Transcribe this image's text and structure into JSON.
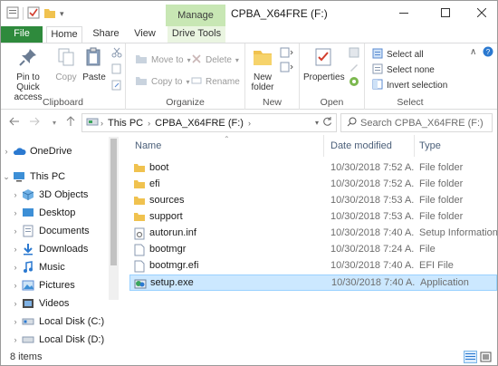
{
  "window": {
    "title": "CPBA_X64FRE (F:)",
    "context_tab": "Manage",
    "controls": {
      "minimize": "—",
      "maximize": "☐",
      "close": "✕"
    }
  },
  "ribbon_tabs": [
    "File",
    "Home",
    "Share",
    "View",
    "Drive Tools"
  ],
  "ribbon": {
    "clipboard": {
      "pin_label": "Pin to Quick access",
      "copy_label": "Copy",
      "paste_label": "Paste",
      "group_label": "Clipboard"
    },
    "organize": {
      "move_to": "Move to",
      "copy_to": "Copy to",
      "delete": "Delete",
      "rename": "Rename",
      "group_label": "Organize"
    },
    "new": {
      "new_folder": "New folder",
      "group_label": "New"
    },
    "open": {
      "properties": "Properties",
      "group_label": "Open"
    },
    "select": {
      "select_all": "Select all",
      "select_none": "Select none",
      "invert_selection": "Invert selection",
      "group_label": "Select"
    }
  },
  "address": {
    "crumbs": [
      "This PC",
      "CPBA_X64FRE (F:)"
    ],
    "search_placeholder": "Search CPBA_X64FRE (F:)"
  },
  "nav": {
    "items": [
      {
        "label": "OneDrive",
        "icon": "cloud-icon"
      },
      {
        "label": "This PC",
        "icon": "computer-icon"
      },
      {
        "label": "3D Objects",
        "icon": "cube-icon"
      },
      {
        "label": "Desktop",
        "icon": "desktop-icon"
      },
      {
        "label": "Documents",
        "icon": "documents-icon"
      },
      {
        "label": "Downloads",
        "icon": "download-icon"
      },
      {
        "label": "Music",
        "icon": "music-icon"
      },
      {
        "label": "Pictures",
        "icon": "pictures-icon"
      },
      {
        "label": "Videos",
        "icon": "videos-icon"
      },
      {
        "label": "Local Disk (C:)",
        "icon": "drive-icon"
      },
      {
        "label": "Local Disk (D:)",
        "icon": "drive-icon"
      }
    ]
  },
  "files": {
    "columns": {
      "name": "Name",
      "date": "Date modified",
      "type": "Type"
    },
    "rows": [
      {
        "name": "boot",
        "date": "10/30/2018 7:52 A...",
        "type": "File folder",
        "icon": "folder-icon"
      },
      {
        "name": "efi",
        "date": "10/30/2018 7:52 A...",
        "type": "File folder",
        "icon": "folder-icon"
      },
      {
        "name": "sources",
        "date": "10/30/2018 7:53 A...",
        "type": "File folder",
        "icon": "folder-icon"
      },
      {
        "name": "support",
        "date": "10/30/2018 7:53 A...",
        "type": "File folder",
        "icon": "folder-icon"
      },
      {
        "name": "autorun.inf",
        "date": "10/30/2018 7:40 A...",
        "type": "Setup Information",
        "icon": "settings-file-icon"
      },
      {
        "name": "bootmgr",
        "date": "10/30/2018 7:24 A...",
        "type": "File",
        "icon": "file-icon"
      },
      {
        "name": "bootmgr.efi",
        "date": "10/30/2018 7:40 A...",
        "type": "EFI File",
        "icon": "file-icon"
      },
      {
        "name": "setup.exe",
        "date": "10/30/2018 7:40 A...",
        "type": "Application",
        "icon": "setup-exe-icon",
        "selected": true
      }
    ]
  },
  "status": {
    "item_count": "8 items"
  },
  "colors": {
    "file_tab": "#2e8a3c",
    "context_tab": "#c8e7b4",
    "selection": "#cce8ff",
    "folder": "#f0c24f"
  }
}
